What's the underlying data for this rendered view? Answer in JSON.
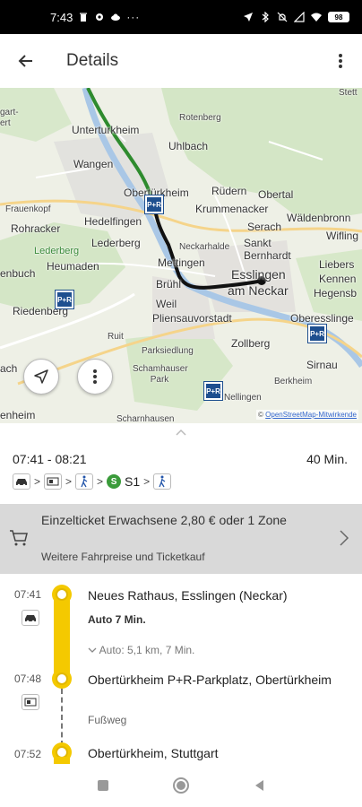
{
  "status_bar": {
    "time": "7:43",
    "icons_left": [
      "trash-icon",
      "gear-icon",
      "cloud-icon",
      "more-horiz-icon"
    ],
    "icons_right": [
      "location-arrow-icon",
      "bluetooth-icon",
      "mute-icon",
      "signal-x-icon",
      "wifi-icon",
      "battery-icon"
    ],
    "battery": "98"
  },
  "app_bar": {
    "back_icon": "arrow-left-icon",
    "title": "Details",
    "menu_icon": "more-vert-icon"
  },
  "map": {
    "labels": [
      "Stett",
      "gart-",
      "ert",
      "Unterturkheim",
      "Rotenberg",
      "Uhlbach",
      "Wangen",
      "Obertürkheim",
      "Rüdern",
      "Obertal",
      "Frauenkopf",
      "Krummenacker",
      "Rohracker",
      "Hedelfingen",
      "Serach",
      "Wäldenbronn",
      "Lederberg",
      "Lederberg",
      "Neckarhalde",
      "Sankt Bernhardt",
      "Wifling",
      "Heumaden",
      "Mettingen",
      "Esslingen",
      "am Neckar",
      "Liebers",
      "Kennen",
      "Hegensb",
      "enbuch",
      "Riedenberg",
      "Brühl",
      "Weil",
      "Pliensauvorstadt",
      "Oberesslinge",
      "Ruit",
      "Zollberg",
      "Parksiedlung",
      "Sirnau",
      "Schamhauser Park",
      "Berkheim",
      "ach",
      "Nellingen",
      "enheim",
      "Scharnhausen"
    ],
    "attribution_prefix": "©",
    "attribution_link": "OpenStreetMap-Mitwirkende",
    "fab_locate_icon": "navigation-arrow-icon",
    "fab_more_icon": "more-vert-icon",
    "pr_label": "P+R",
    "colors": {
      "route_walk": "#2e8b2e",
      "route_drive": "#000000",
      "pr_badge": "#1e4f8f"
    }
  },
  "summary": {
    "time_range": "07:41 - 08:21",
    "duration": "40 Min.",
    "modes": [
      "car-icon",
      "parking-ticket-icon",
      "walk-icon",
      "sbahn-icon",
      "walk-icon"
    ],
    "separator": ">",
    "s_badge": "S",
    "line": "S1"
  },
  "ticket": {
    "title": "Einzelticket Erwachsene 2,80 € oder 1 Zone",
    "subtitle": "Weitere Fahrpreise und Ticketkauf",
    "cart_icon": "shopping-cart-icon",
    "chevron_icon": "chevron-right-icon"
  },
  "itinerary": {
    "stops": [
      {
        "time": "07:41",
        "name": "Neues Rathaus, Esslingen (Neckar)",
        "icon": "car-icon"
      },
      {
        "time": "07:48",
        "name": "Obertürkheim P+R-Parkplatz, Obertürkheim",
        "icon": "parking-ticket-icon"
      },
      {
        "time": "07:52",
        "name": "Obertürkheim, Stuttgart"
      }
    ],
    "legs": [
      {
        "mode": "Auto 7 Min.",
        "detail": "Auto: 5,1 km, 7 Min."
      },
      {
        "mode": "Fußweg"
      }
    ],
    "accent": "#f4c900"
  },
  "nav_bar": {
    "icons": [
      "recents-square-icon",
      "home-circle-icon",
      "back-triangle-icon"
    ]
  }
}
